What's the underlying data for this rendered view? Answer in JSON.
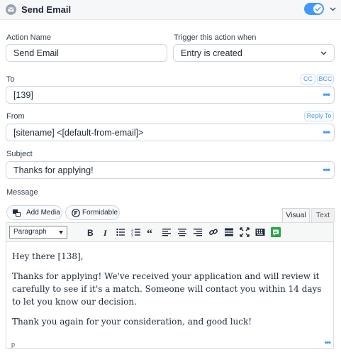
{
  "header": {
    "title": "Send Email",
    "icon": "envelope-icon",
    "enabled": true
  },
  "labels": {
    "action_name": "Action Name",
    "trigger": "Trigger this action when",
    "to": "To",
    "from": "From",
    "subject": "Subject",
    "message": "Message"
  },
  "fields": {
    "action_name": "Send Email",
    "trigger": "Entry is created",
    "to": "[139]",
    "from": "[sitename] <[default-from-email]>",
    "subject": "Thanks for applying!"
  },
  "pills": {
    "cc": "CC",
    "bcc": "BCC",
    "reply_to": "Reply To"
  },
  "media_buttons": {
    "add_media": "Add Media",
    "formidable": "Formidable"
  },
  "tabs": {
    "visual": "Visual",
    "text": "Text"
  },
  "toolbar": {
    "format": "Paragraph"
  },
  "message": {
    "paragraphs": [
      "Hey there [138],",
      "Thanks for applying! We've received your application and will review it carefully to see if it's a match. Someone will contact you within 14 days to let you know our decision.",
      "Thank you again for your consideration, and good luck!"
    ],
    "status_path": "p"
  },
  "colors": {
    "accent": "#4199fd",
    "kitchen_sink": "#28a745"
  }
}
